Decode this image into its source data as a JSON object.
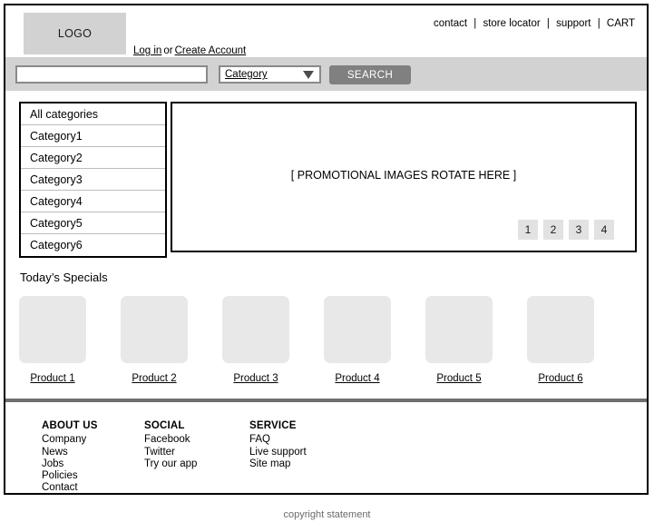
{
  "header": {
    "logo_text": "LOGO",
    "utility_nav": [
      {
        "label": "contact"
      },
      {
        "label": "store locator"
      },
      {
        "label": "support"
      },
      {
        "label": "CART"
      }
    ],
    "separator": "|",
    "account": {
      "login_label": "Log in",
      "connector": "or",
      "create_label": "Create Account"
    }
  },
  "search": {
    "input_value": "",
    "input_placeholder": "",
    "category_label": "Category",
    "button_label": "SEARCH"
  },
  "sidebar": {
    "items": [
      {
        "label": "All categories"
      },
      {
        "label": "Category1"
      },
      {
        "label": "Category2"
      },
      {
        "label": "Category3"
      },
      {
        "label": "Category4"
      },
      {
        "label": "Category5"
      },
      {
        "label": "Category6"
      }
    ]
  },
  "promo": {
    "placeholder_text": "[ PROMOTIONAL IMAGES ROTATE HERE ]",
    "pagination": [
      {
        "label": "1"
      },
      {
        "label": "2"
      },
      {
        "label": "3"
      },
      {
        "label": "4"
      }
    ]
  },
  "specials": {
    "title": "Today’s Specials",
    "products": [
      {
        "label": "Product 1"
      },
      {
        "label": "Product 2"
      },
      {
        "label": "Product 3"
      },
      {
        "label": "Product 4"
      },
      {
        "label": "Product 5"
      },
      {
        "label": "Product 6"
      }
    ]
  },
  "footer": {
    "columns": [
      {
        "heading": "ABOUT US",
        "links": [
          {
            "label": "Company"
          },
          {
            "label": "News"
          },
          {
            "label": "Jobs"
          },
          {
            "label": "Policies"
          },
          {
            "label": "Contact"
          }
        ]
      },
      {
        "heading": "SOCIAL",
        "links": [
          {
            "label": "Facebook"
          },
          {
            "label": "Twitter"
          },
          {
            "label": "Try our app"
          }
        ]
      },
      {
        "heading": "SERVICE",
        "links": [
          {
            "label": "FAQ"
          },
          {
            "label": "Live support"
          },
          {
            "label": "Site map"
          }
        ]
      }
    ]
  },
  "copyright": {
    "text": "copyright statement"
  },
  "colors": {
    "band_gray": "#d2d2d2",
    "logo_gray": "#d2d2d2",
    "button_gray": "#808080",
    "thumb_gray": "#e8e8e8",
    "pagination_gray": "#e2e2e2",
    "divider_gray": "#6e6e6e",
    "border_black": "#000000"
  }
}
